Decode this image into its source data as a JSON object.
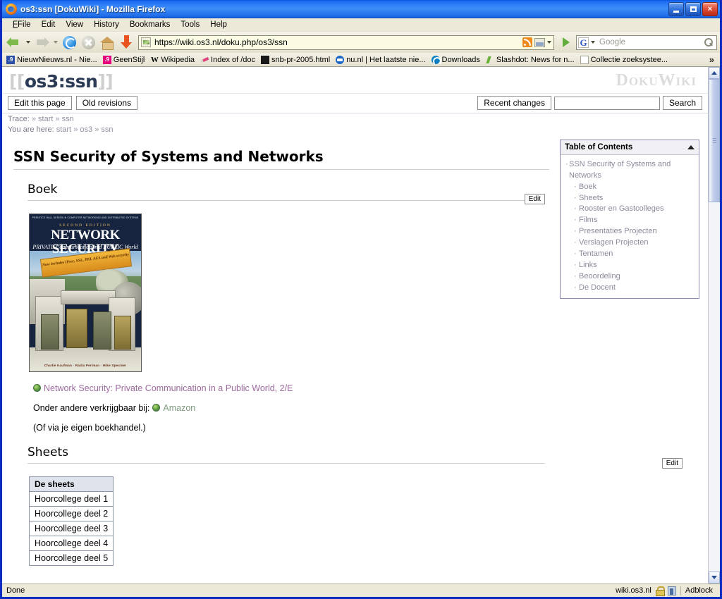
{
  "window": {
    "title": "os3:ssn [DokuWiki] - Mozilla Firefox",
    "app_icon": "firefox-icon",
    "minimize_label": "minimize-icon",
    "maximize_label": "maximize-icon",
    "close_label": "×"
  },
  "menu": [
    {
      "label": "File",
      "accel": "F"
    },
    {
      "label": "Edit",
      "accel": "E"
    },
    {
      "label": "View",
      "accel": "V"
    },
    {
      "label": "History",
      "accel": "s"
    },
    {
      "label": "Bookmarks",
      "accel": "B"
    },
    {
      "label": "Tools",
      "accel": "T"
    },
    {
      "label": "Help",
      "accel": "H"
    }
  ],
  "toolbar": {
    "back_icon": "back-arrow-icon",
    "forward_icon": "forward-arrow-icon",
    "reload_icon": "reload-icon",
    "stop_icon": "stop-icon",
    "home_icon": "home-icon",
    "download_icon": "download-arrow-icon",
    "url": "https://wiki.os3.nl/doku.php/os3/ssn",
    "url_favicon": "site-favicon-icon",
    "rss_icon": "rss-feed-icon",
    "image_icon": "page-image-icon",
    "go_icon": "go-arrow-icon",
    "search_engine": "G",
    "search_placeholder": "Google",
    "search_value": "",
    "search_icon": "magnifier-icon"
  },
  "bookmarks": {
    "items": [
      {
        "label": "NieuwNieuws.nl - Nie...",
        "icon": "nieuwnieuws-favicon",
        "cls": "nn",
        "glyph": ".9"
      },
      {
        "label": "GeenStijl",
        "icon": "geenstijl-favicon",
        "cls": "gs",
        "glyph": ".9"
      },
      {
        "label": "Wikipedia",
        "icon": "wikipedia-favicon",
        "cls": "wp",
        "glyph": "W"
      },
      {
        "label": "Index of /doc",
        "icon": "pencil-favicon",
        "cls": "pen",
        "glyph": ""
      },
      {
        "label": "snb-pr-2005.html",
        "icon": "document-favicon",
        "cls": "snb",
        "glyph": ""
      },
      {
        "label": "nu.nl | Het laatste nie...",
        "icon": "nunl-favicon",
        "cls": "nu",
        "glyph": ""
      },
      {
        "label": "Downloads",
        "icon": "downloads-favicon",
        "cls": "dl",
        "glyph": ""
      },
      {
        "label": "Slashdot: News for n...",
        "icon": "slashdot-favicon",
        "cls": "sd",
        "glyph": ""
      },
      {
        "label": "Collectie zoeksystee...",
        "icon": "blank-page-favicon",
        "cls": "doc",
        "glyph": ""
      }
    ],
    "overflow_label": "»"
  },
  "wiki": {
    "title_open_bracket": "[[",
    "title_text": "os3:ssn",
    "title_close_bracket": "]]",
    "logo": "DokuWiki",
    "buttons": {
      "edit_this_page": "Edit this page",
      "old_revisions": "Old revisions",
      "recent_changes": "Recent changes",
      "search": "Search",
      "search_value": "",
      "section_edit": "Edit"
    },
    "trace": {
      "label": "Trace:",
      "sep": "»",
      "items": [
        "start",
        "ssn"
      ],
      "here_label": "You are here:",
      "here_items": [
        "start",
        "os3",
        "ssn"
      ]
    },
    "toc": {
      "header": "Table of Contents",
      "collapse_icon": "triangle-up-icon",
      "items": [
        {
          "label": "SSN Security of Systems and Networks",
          "level": 1
        },
        {
          "label": "Boek",
          "level": 2
        },
        {
          "label": "Sheets",
          "level": 2
        },
        {
          "label": "Rooster en Gastcolleges",
          "level": 2
        },
        {
          "label": "Films",
          "level": 2
        },
        {
          "label": "Presentaties Projecten",
          "level": 2
        },
        {
          "label": "Verslagen Projecten",
          "level": 2
        },
        {
          "label": "Tentamen",
          "level": 2
        },
        {
          "label": "Links",
          "level": 2
        },
        {
          "label": "Beoordeling",
          "level": 2
        },
        {
          "label": "De Docent",
          "level": 2
        }
      ]
    },
    "page_heading": "SSN Security of Systems and Networks",
    "sections": {
      "boek": {
        "heading": "Boek",
        "cover": {
          "top_band": "PRENTICE HALL SERIES IN COMPUTER NETWORKING AND DISTRIBUTED SYSTEMS",
          "edition": "SECOND EDITION",
          "title": "NETWORK SECURITY",
          "subtitle": "PRIVATE Communication in a PUBLIC World",
          "burst": "Now includes IPsec, SSL, PKI, AES and Web security",
          "authors": "Charlie Kaufman · Radia Perlman · Mike Speciner"
        },
        "book_link": "Network Security: Private Communication in a Public World, 2/E",
        "buy_prefix": "Onder andere verkrijgbaar bij:",
        "buy_link": "Amazon",
        "note": "(Of via je eigen boekhandel.)",
        "external_icon": "external-link-globe-icon"
      },
      "sheets": {
        "heading": "Sheets",
        "table": {
          "headers": [
            "De sheets"
          ],
          "rows": [
            [
              "Hoorcollege deel 1"
            ],
            [
              "Hoorcollege deel 2"
            ],
            [
              "Hoorcollege deel 3"
            ],
            [
              "Hoorcollege deel 4"
            ],
            [
              "Hoorcollege deel 5"
            ]
          ]
        }
      }
    }
  },
  "statusbar": {
    "status": "Done",
    "host": "wiki.os3.nl",
    "lock_icon": "padlock-icon",
    "security_icon": "security-certificate-icon",
    "adblock": "Adblock"
  },
  "colors": {
    "titlebar_blue": "#1d6df5",
    "chrome_beige": "#ece9d8",
    "url_yellow": "#fbfbe4",
    "wiki_title": "#2b3a55",
    "visited_link": "#9d6a9d",
    "green_link": "#7f9a7f",
    "toc_text": "#8a8a9c"
  }
}
